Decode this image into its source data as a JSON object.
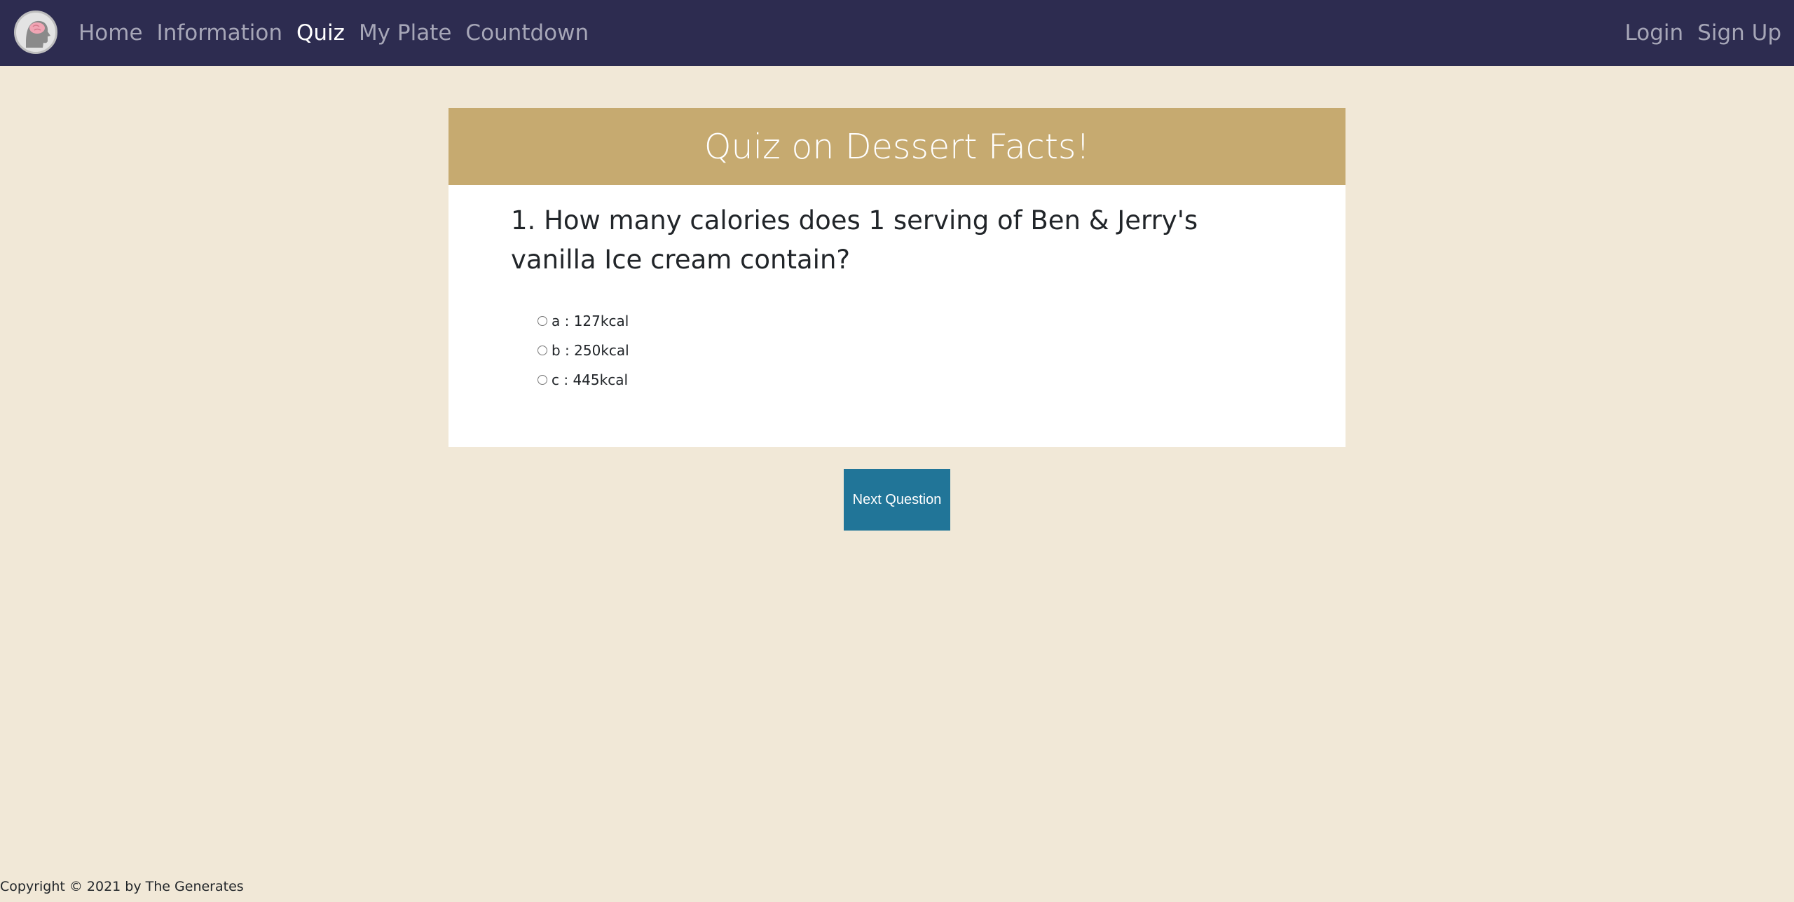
{
  "nav": {
    "logo_icon": "brain-head-icon",
    "left_links": [
      {
        "label": "Home",
        "active": false
      },
      {
        "label": "Information",
        "active": false
      },
      {
        "label": "Quiz",
        "active": true
      },
      {
        "label": "My Plate",
        "active": false
      },
      {
        "label": "Countdown",
        "active": false
      }
    ],
    "right_links": [
      {
        "label": "Login"
      },
      {
        "label": "Sign Up"
      }
    ]
  },
  "quiz": {
    "title": "Quiz on Dessert Facts!",
    "question": "1. How many calories does 1 serving of Ben & Jerry's vanilla Ice cream contain?",
    "options": [
      {
        "label": "a : 127kcal",
        "selected": false
      },
      {
        "label": "b : 250kcal",
        "selected": false
      },
      {
        "label": "c : 445kcal",
        "selected": false
      }
    ],
    "next_label": "Next Question"
  },
  "footer": {
    "text": "Copyright © 2021 by The Generates"
  },
  "colors": {
    "page_bg": "#f1e8d7",
    "navbar_bg": "#2d2c50",
    "quiz_header_bg": "#c6aa70",
    "button_bg": "#217598"
  }
}
